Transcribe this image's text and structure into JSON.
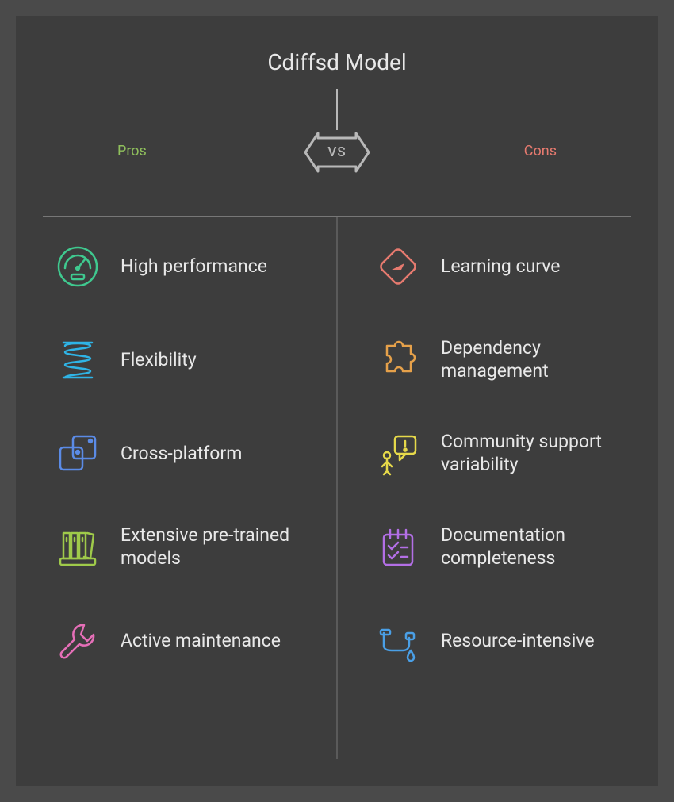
{
  "title": "Cdiffsd Model",
  "vs": "VS",
  "headers": {
    "pros": "Pros",
    "cons": "Cons"
  },
  "pros": [
    {
      "label": "High performance"
    },
    {
      "label": "Flexibility"
    },
    {
      "label": "Cross-platform"
    },
    {
      "label": "Extensive pre-trained models"
    },
    {
      "label": "Active maintenance"
    }
  ],
  "cons": [
    {
      "label": "Learning curve"
    },
    {
      "label": "Dependency management"
    },
    {
      "label": "Community support variability"
    },
    {
      "label": "Documentation completeness"
    },
    {
      "label": "Resource-intensive"
    }
  ],
  "colors": {
    "pros": "#8fbf5c",
    "cons": "#e67a6f",
    "icon_gauge": "#3fc98f",
    "icon_spring": "#2fb4e6",
    "icon_platform": "#5b8be6",
    "icon_library": "#9fca4a",
    "icon_wrench": "#e66fb8",
    "icon_warning": "#e67a6f",
    "icon_puzzle": "#e6a14a",
    "icon_support": "#e6d94a",
    "icon_docs": "#b36fe6",
    "icon_resource": "#4a9fe6"
  }
}
